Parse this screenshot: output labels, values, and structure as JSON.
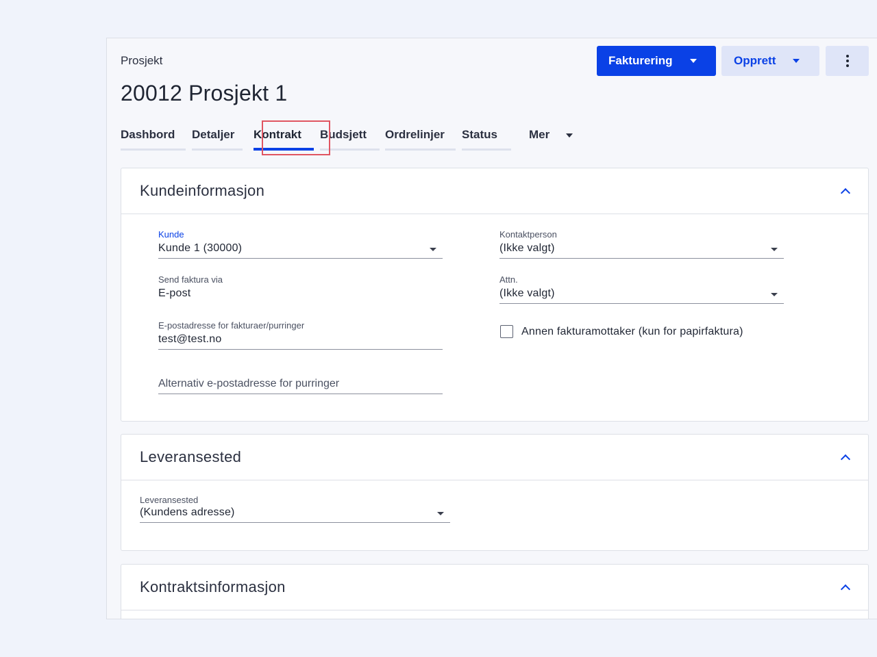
{
  "header": {
    "breadcrumb": "Prosjekt",
    "title": "20012 Prosjekt 1",
    "buttons": {
      "fakturering": "Fakturering",
      "opprett": "Opprett"
    }
  },
  "tabs": {
    "items": [
      {
        "label": "Dashbord"
      },
      {
        "label": "Detaljer"
      },
      {
        "label": "Kontrakt"
      },
      {
        "label": "Budsjett"
      },
      {
        "label": "Ordrelinjer"
      },
      {
        "label": "Status"
      },
      {
        "label": "Mer"
      }
    ],
    "active": "Kontrakt"
  },
  "colors": {
    "accent": "#0a41e6",
    "highlight": "#e05561"
  },
  "sections": {
    "kundeinformasjon": {
      "title": "Kundeinformasjon",
      "kunde": {
        "label": "Kunde",
        "value": "Kunde 1 (30000)"
      },
      "kontaktperson": {
        "label": "Kontaktperson",
        "value": "(Ikke valgt)"
      },
      "send_faktura": {
        "label": "Send faktura via",
        "value": "E-post"
      },
      "attn": {
        "label": "Attn.",
        "value": "(Ikke valgt)"
      },
      "epost": {
        "label": "E-postadresse for fakturaer/purringer",
        "value": "test@test.no"
      },
      "annen_mottaker": {
        "label": "Annen fakturamottaker (kun for papirfaktura)",
        "checked": false
      },
      "alt_epost": {
        "placeholder": "Alternativ e-postadresse for purringer"
      }
    },
    "leveransested": {
      "title": "Leveransested",
      "field": {
        "label": "Leveransested",
        "value": "(Kundens adresse)"
      }
    },
    "kontraktsinformasjon": {
      "title": "Kontraktsinformasjon"
    }
  }
}
